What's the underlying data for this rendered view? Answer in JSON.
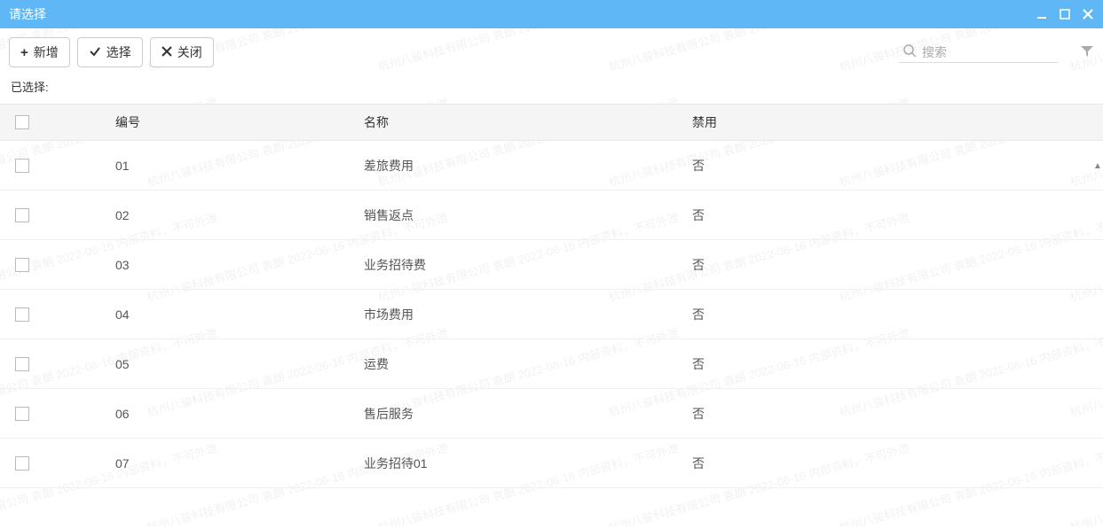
{
  "window": {
    "title": "请选择"
  },
  "toolbar": {
    "add_label": "新增",
    "select_label": "选择",
    "close_label": "关闭"
  },
  "search": {
    "placeholder": "搜索"
  },
  "selected": {
    "label": "已选择:"
  },
  "table": {
    "headers": {
      "code": "编号",
      "name": "名称",
      "disabled": "禁用"
    },
    "rows": [
      {
        "code": "01",
        "name": "差旅费用",
        "disabled": "否"
      },
      {
        "code": "02",
        "name": "销售返点",
        "disabled": "否"
      },
      {
        "code": "03",
        "name": "业务招待费",
        "disabled": "否"
      },
      {
        "code": "04",
        "name": "市场费用",
        "disabled": "否"
      },
      {
        "code": "05",
        "name": "运费",
        "disabled": "否"
      },
      {
        "code": "06",
        "name": "售后服务",
        "disabled": "否"
      },
      {
        "code": "07",
        "name": "业务招待01",
        "disabled": "否"
      }
    ]
  },
  "watermark": {
    "text": "杭州八骏科技有限公司 袁朗 2022-06-16 内部资料，不可外泄"
  }
}
